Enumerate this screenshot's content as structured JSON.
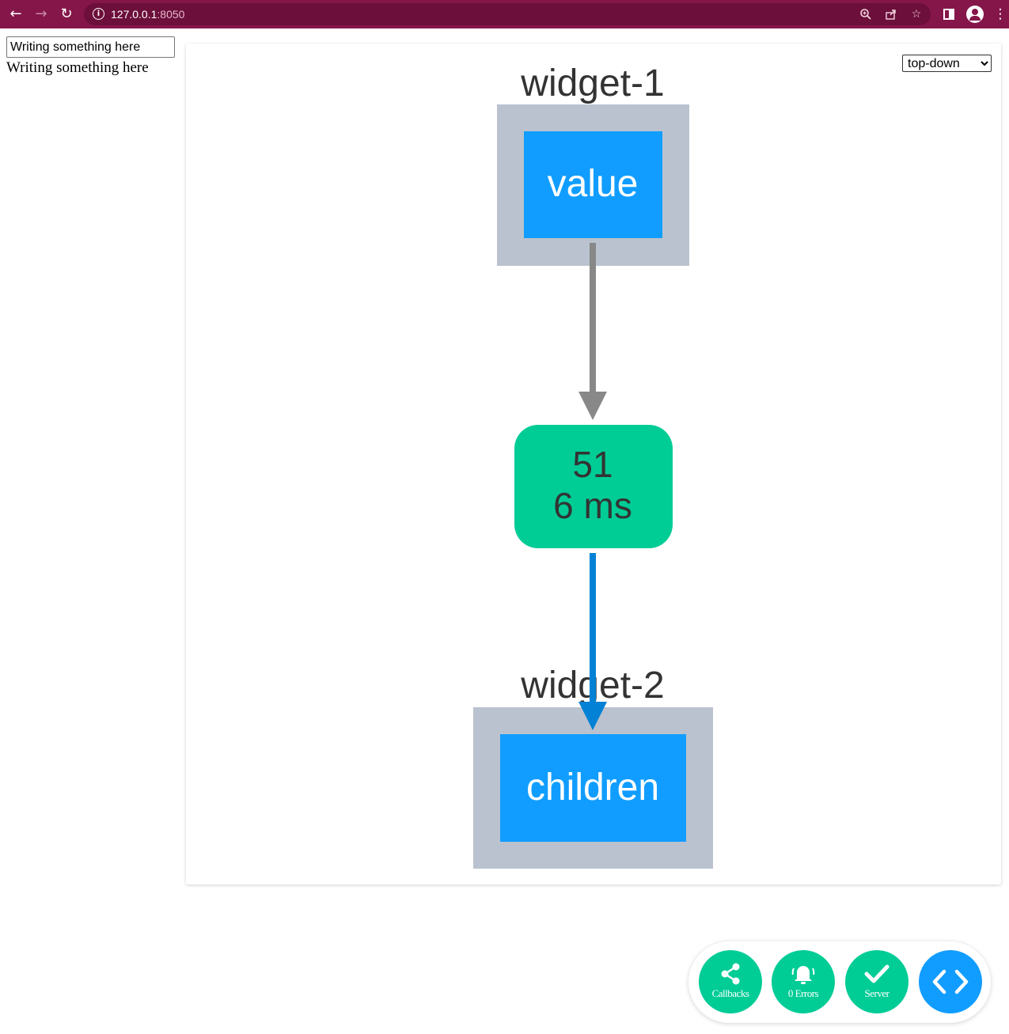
{
  "browser": {
    "url_host": "127.0.0.1",
    "url_port": ":8050",
    "theme_color": "#85164a",
    "icons": [
      "back-arrow-icon",
      "forward-arrow-icon",
      "reload-icon",
      "site-info-icon",
      "zoom-icon",
      "share-icon",
      "bookmark-star-icon",
      "side-panel-icon",
      "profile-icon",
      "more-menu-icon"
    ]
  },
  "app": {
    "input_value": "Writing something here",
    "output_text": "Writing something here"
  },
  "graph": {
    "layout_options": [
      "top-down"
    ],
    "layout_selected": "top-down",
    "nodes": {
      "source_component": "widget-1",
      "source_property": "value",
      "callback_count": "51",
      "callback_time": "6 ms",
      "target_component": "widget-2",
      "target_property": "children"
    },
    "colors": {
      "component_box": "#b9c2ce",
      "property_box": "#119dff",
      "callback_node": "#00cc96",
      "input_edge": "#888888",
      "output_edge": "#0381d5"
    }
  },
  "devtools": {
    "callbacks_label": "Callbacks",
    "errors_label": "0 Errors",
    "server_label": "Server",
    "icons": [
      "share-graph-icon",
      "bell-icon",
      "checkmark-icon",
      "code-brackets-icon"
    ],
    "colors": {
      "green": "#00cc96",
      "blue": "#119dff"
    }
  }
}
